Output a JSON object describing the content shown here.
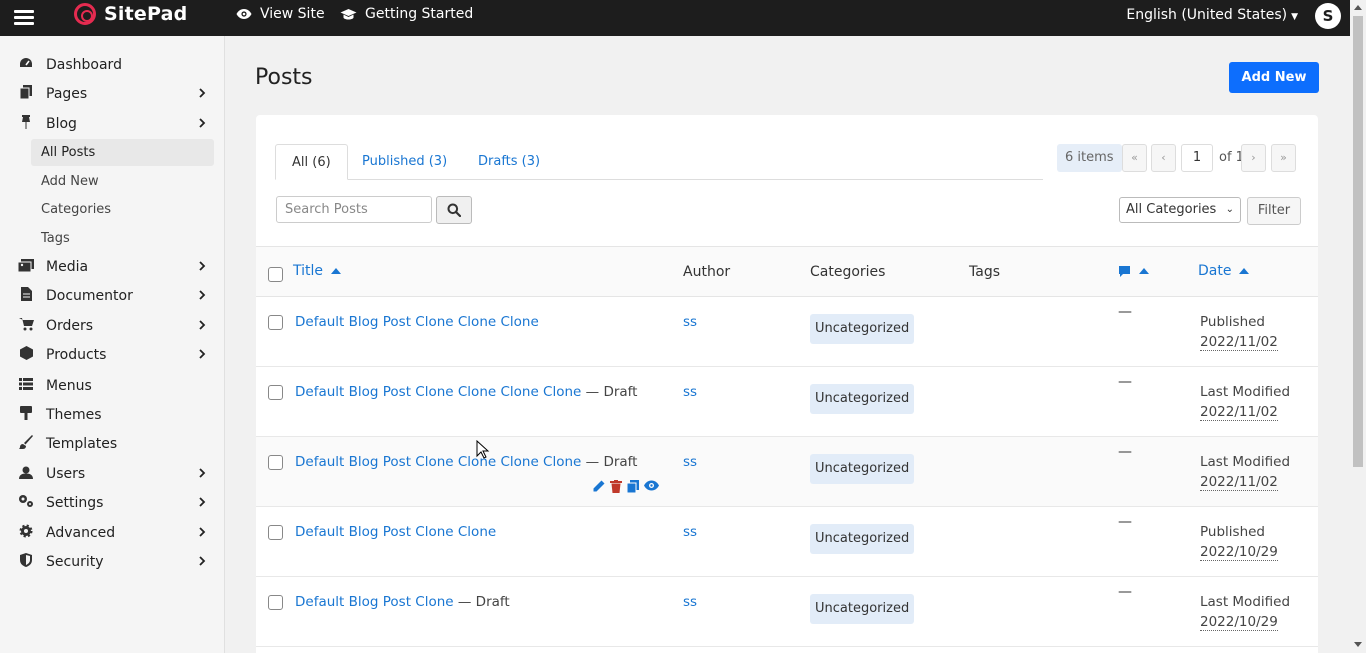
{
  "app": {
    "name": "SitePad"
  },
  "topbar": {
    "view_site": "View Site",
    "getting_started": "Getting Started",
    "language": "English (United States)",
    "avatar_initial": "S"
  },
  "sidebar": {
    "items": [
      {
        "label": "Dashboard",
        "icon": "dashboard-icon",
        "has_arrow": false
      },
      {
        "label": "Pages",
        "icon": "pages-icon",
        "has_arrow": true
      },
      {
        "label": "Blog",
        "icon": "pin-icon",
        "has_arrow": true
      },
      {
        "label": "Media",
        "icon": "media-icon",
        "has_arrow": true
      },
      {
        "label": "Documentor",
        "icon": "document-icon",
        "has_arrow": true
      },
      {
        "label": "Orders",
        "icon": "cart-icon",
        "has_arrow": true
      },
      {
        "label": "Products",
        "icon": "box-icon",
        "has_arrow": true
      },
      {
        "label": "Menus",
        "icon": "menu-list-icon",
        "has_arrow": false
      },
      {
        "label": "Themes",
        "icon": "brush-icon",
        "has_arrow": false
      },
      {
        "label": "Templates",
        "icon": "paint-brush-icon",
        "has_arrow": false
      },
      {
        "label": "Users",
        "icon": "users-icon",
        "has_arrow": true
      },
      {
        "label": "Settings",
        "icon": "settings-icon",
        "has_arrow": true
      },
      {
        "label": "Advanced",
        "icon": "gear-icon",
        "has_arrow": true
      },
      {
        "label": "Security",
        "icon": "shield-icon",
        "has_arrow": true
      }
    ],
    "blog_sub": [
      "All Posts",
      "Add New",
      "Categories",
      "Tags"
    ]
  },
  "main": {
    "title": "Posts",
    "add_new": "Add New",
    "tabs": [
      "All (6)",
      "Published (3)",
      "Drafts (3)"
    ],
    "items_count": "6 items",
    "pager": {
      "first": "«",
      "prev": "‹",
      "page": "1",
      "of": "of 1",
      "next": "›",
      "last": "»"
    },
    "search_placeholder": "Search Posts",
    "category_select": "All Categories",
    "filter": "Filter",
    "columns": {
      "title": "Title",
      "author": "Author",
      "categories": "Categories",
      "tags": "Tags",
      "date": "Date"
    },
    "rows": [
      {
        "title": "Default Blog Post Clone Clone Clone",
        "draft": "",
        "author": "ss",
        "category": "Uncategorized",
        "comments": "—",
        "status": "Published",
        "date": "2022/11/02"
      },
      {
        "title": "Default Blog Post Clone Clone Clone Clone",
        "draft": " — Draft",
        "author": "ss",
        "category": "Uncategorized",
        "comments": "—",
        "status": "Last Modified",
        "date": "2022/11/02"
      },
      {
        "title": "Default Blog Post Clone Clone Clone Clone",
        "draft": " — Draft",
        "author": "ss",
        "category": "Uncategorized",
        "comments": "—",
        "status": "Last Modified",
        "date": "2022/11/02"
      },
      {
        "title": "Default Blog Post Clone Clone",
        "draft": "",
        "author": "ss",
        "category": "Uncategorized",
        "comments": "—",
        "status": "Published",
        "date": "2022/10/29"
      },
      {
        "title": "Default Blog Post Clone",
        "draft": " — Draft",
        "author": "ss",
        "category": "Uncategorized",
        "comments": "—",
        "status": "Last Modified",
        "date": "2022/10/29"
      }
    ]
  },
  "colors": {
    "topbar": "#1d1d1d",
    "accent": "#0d6efd",
    "link": "#1976d2",
    "logo": "#e52b50"
  }
}
